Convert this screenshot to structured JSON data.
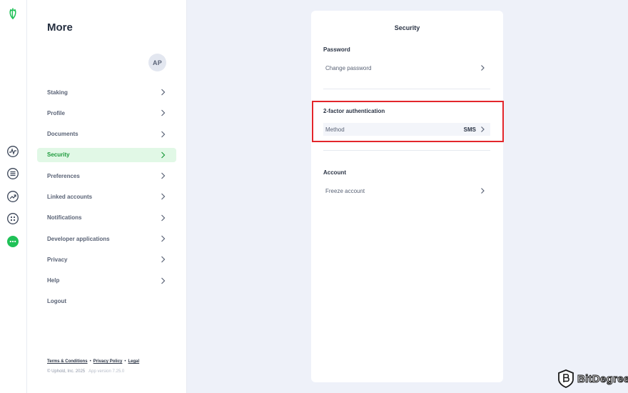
{
  "rail": {
    "icons": [
      "uphold-logo-icon",
      "activity-icon",
      "transactions-icon",
      "trade-icon",
      "apps-icon",
      "more-icon"
    ],
    "accent_color": "#1fc157"
  },
  "menu": {
    "title": "More",
    "avatar_initials": "AP",
    "items": [
      {
        "label": "Staking",
        "active": false
      },
      {
        "label": "Profile",
        "active": false
      },
      {
        "label": "Documents",
        "active": false
      },
      {
        "label": "Security",
        "active": true
      },
      {
        "label": "Preferences",
        "active": false
      },
      {
        "label": "Linked accounts",
        "active": false
      },
      {
        "label": "Notifications",
        "active": false
      },
      {
        "label": "Developer applications",
        "active": false
      },
      {
        "label": "Privacy",
        "active": false
      },
      {
        "label": "Help",
        "active": false
      },
      {
        "label": "Logout",
        "active": false
      }
    ],
    "footer": {
      "terms": "Terms & Conditions",
      "privacy": "Privacy Policy",
      "legal": "Legal",
      "copyright": "© Uphold, Inc. 2025",
      "version": "App version 7.25.0"
    }
  },
  "security": {
    "title": "Security",
    "password_heading": "Password",
    "change_password": "Change password",
    "twofa_heading": "2-factor authentication",
    "method_label": "Method",
    "method_value": "SMS",
    "account_heading": "Account",
    "freeze_account": "Freeze account"
  },
  "colors": {
    "active_bg": "#e1f8e6",
    "active_text": "#1d9a3c",
    "highlight_border": "#e3262b",
    "page_bg": "#eef1f9"
  },
  "watermark": {
    "text": "BitDegree"
  }
}
